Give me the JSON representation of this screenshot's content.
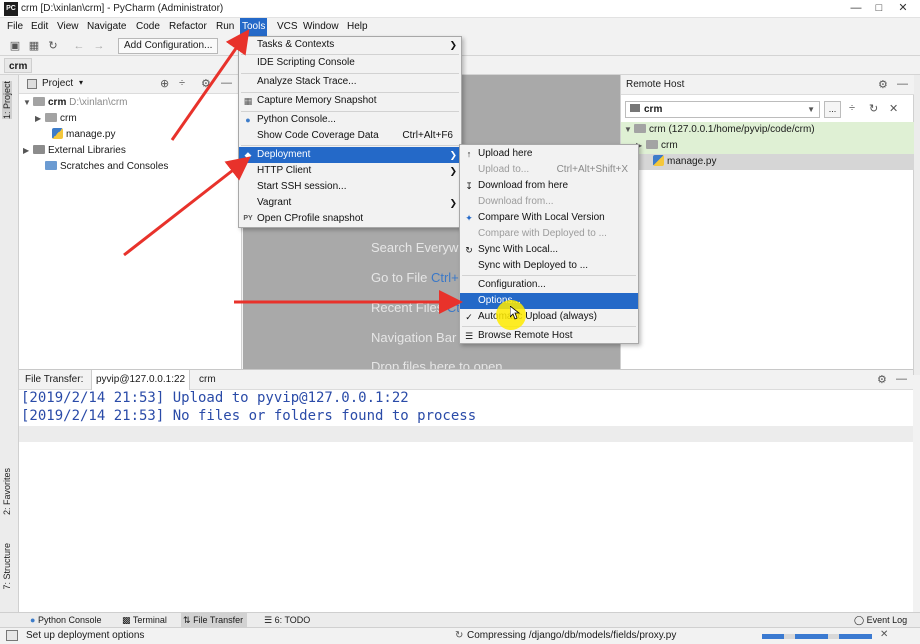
{
  "window": {
    "app_icon": "PC",
    "title": "crm [D:\\xinlan\\crm] - PyCharm (Administrator)",
    "controls": [
      "minimize-icon",
      "maximize-icon",
      "close-icon"
    ]
  },
  "menubar": {
    "items": [
      "File",
      "Edit",
      "View",
      "Navigate",
      "Code",
      "Refactor",
      "Run",
      "Tools",
      "VCS",
      "Window",
      "Help"
    ]
  },
  "toolbar": {
    "add_config": "Add Configuration..."
  },
  "breadcrumb": {
    "item": "crm"
  },
  "left_stripe": {
    "project": "1: Project",
    "favorites": "2: Favorites",
    "structure": "7: Structure"
  },
  "project_panel": {
    "title": "Project",
    "root_name": "crm",
    "root_path": "D:\\xinlan\\crm",
    "items": [
      "crm",
      "manage.py",
      "External Libraries",
      "Scratches and Consoles"
    ]
  },
  "editor": {
    "hints": [
      {
        "text": "Search Everywh",
        "key": ""
      },
      {
        "text": "Go to File ",
        "key": "Ctrl+"
      },
      {
        "text": "Recent Files ",
        "key": "Ctr"
      },
      {
        "text": "Navigation Bar",
        "key": ""
      },
      {
        "text": "Drop files here to open",
        "key": ""
      }
    ]
  },
  "remote_host": {
    "title": "Remote Host",
    "server": "crm",
    "more": "...",
    "root": "crm (127.0.0.1/home/pyvip/code/crm)",
    "folder": "crm",
    "file": "manage.py"
  },
  "tools_menu": {
    "items": [
      {
        "label": "Tasks & Contexts",
        "submenu": true
      },
      {
        "label": "IDE Scripting Console"
      },
      {
        "label": "Analyze Stack Trace..."
      },
      {
        "label": "Capture Memory Snapshot",
        "icon": "memory-icon"
      },
      {
        "label": "Python Console...",
        "icon": "python-icon"
      },
      {
        "label": "Show Code Coverage Data",
        "shortcut": "Ctrl+Alt+F6"
      },
      {
        "label": "Deployment",
        "submenu": true,
        "selected": true
      },
      {
        "label": "HTTP Client",
        "submenu": true
      },
      {
        "label": "Start SSH session..."
      },
      {
        "label": "Vagrant",
        "submenu": true
      },
      {
        "label": "Open CProfile snapshot",
        "icon": "profile-icon"
      }
    ]
  },
  "deployment_menu": {
    "items": [
      {
        "label": "Upload here",
        "icon": "upload-icon"
      },
      {
        "label": "Upload to...",
        "shortcut": "Ctrl+Alt+Shift+X",
        "disabled": true
      },
      {
        "label": "Download from here",
        "icon": "download-icon"
      },
      {
        "label": "Download from...",
        "disabled": true
      },
      {
        "label": "Compare With Local Version",
        "icon": "compare-icon"
      },
      {
        "label": "Compare with Deployed to ...",
        "disabled": true
      },
      {
        "label": "Sync With Local...",
        "icon": "sync-icon"
      },
      {
        "label": "Sync with Deployed to ..."
      },
      {
        "label": "Configuration..."
      },
      {
        "label": "Options...",
        "selected": true
      },
      {
        "label": "Automatic Upload (always)",
        "icon": "check-icon"
      },
      {
        "label": "Browse Remote Host",
        "icon": "list-icon"
      }
    ]
  },
  "file_transfer": {
    "label": "File Transfer:",
    "tabs": [
      "pyvip@127.0.0.1:22",
      "crm"
    ],
    "log": [
      "[2019/2/14 21:53] Upload to pyvip@127.0.0.1:22",
      "[2019/2/14 21:53] No files or folders found to process"
    ]
  },
  "bottom_tabs": {
    "items": [
      {
        "label": "Python Console",
        "icon": "python-icon"
      },
      {
        "label": "Terminal",
        "icon": "terminal-icon"
      },
      {
        "label": "File Transfer",
        "icon": "transfer-icon",
        "selected": true
      },
      {
        "label": "6: TODO",
        "icon": "todo-icon"
      }
    ],
    "event_log": "Event Log"
  },
  "status": {
    "left": "Set up deployment options",
    "center": "Compressing /django/db/models/fields/proxy.py"
  },
  "colors": {
    "accent": "#2469c8",
    "log_text": "#2a4ba8",
    "annotation_arrow": "#e8322b",
    "cursor_highlight": "#ffeb00"
  }
}
